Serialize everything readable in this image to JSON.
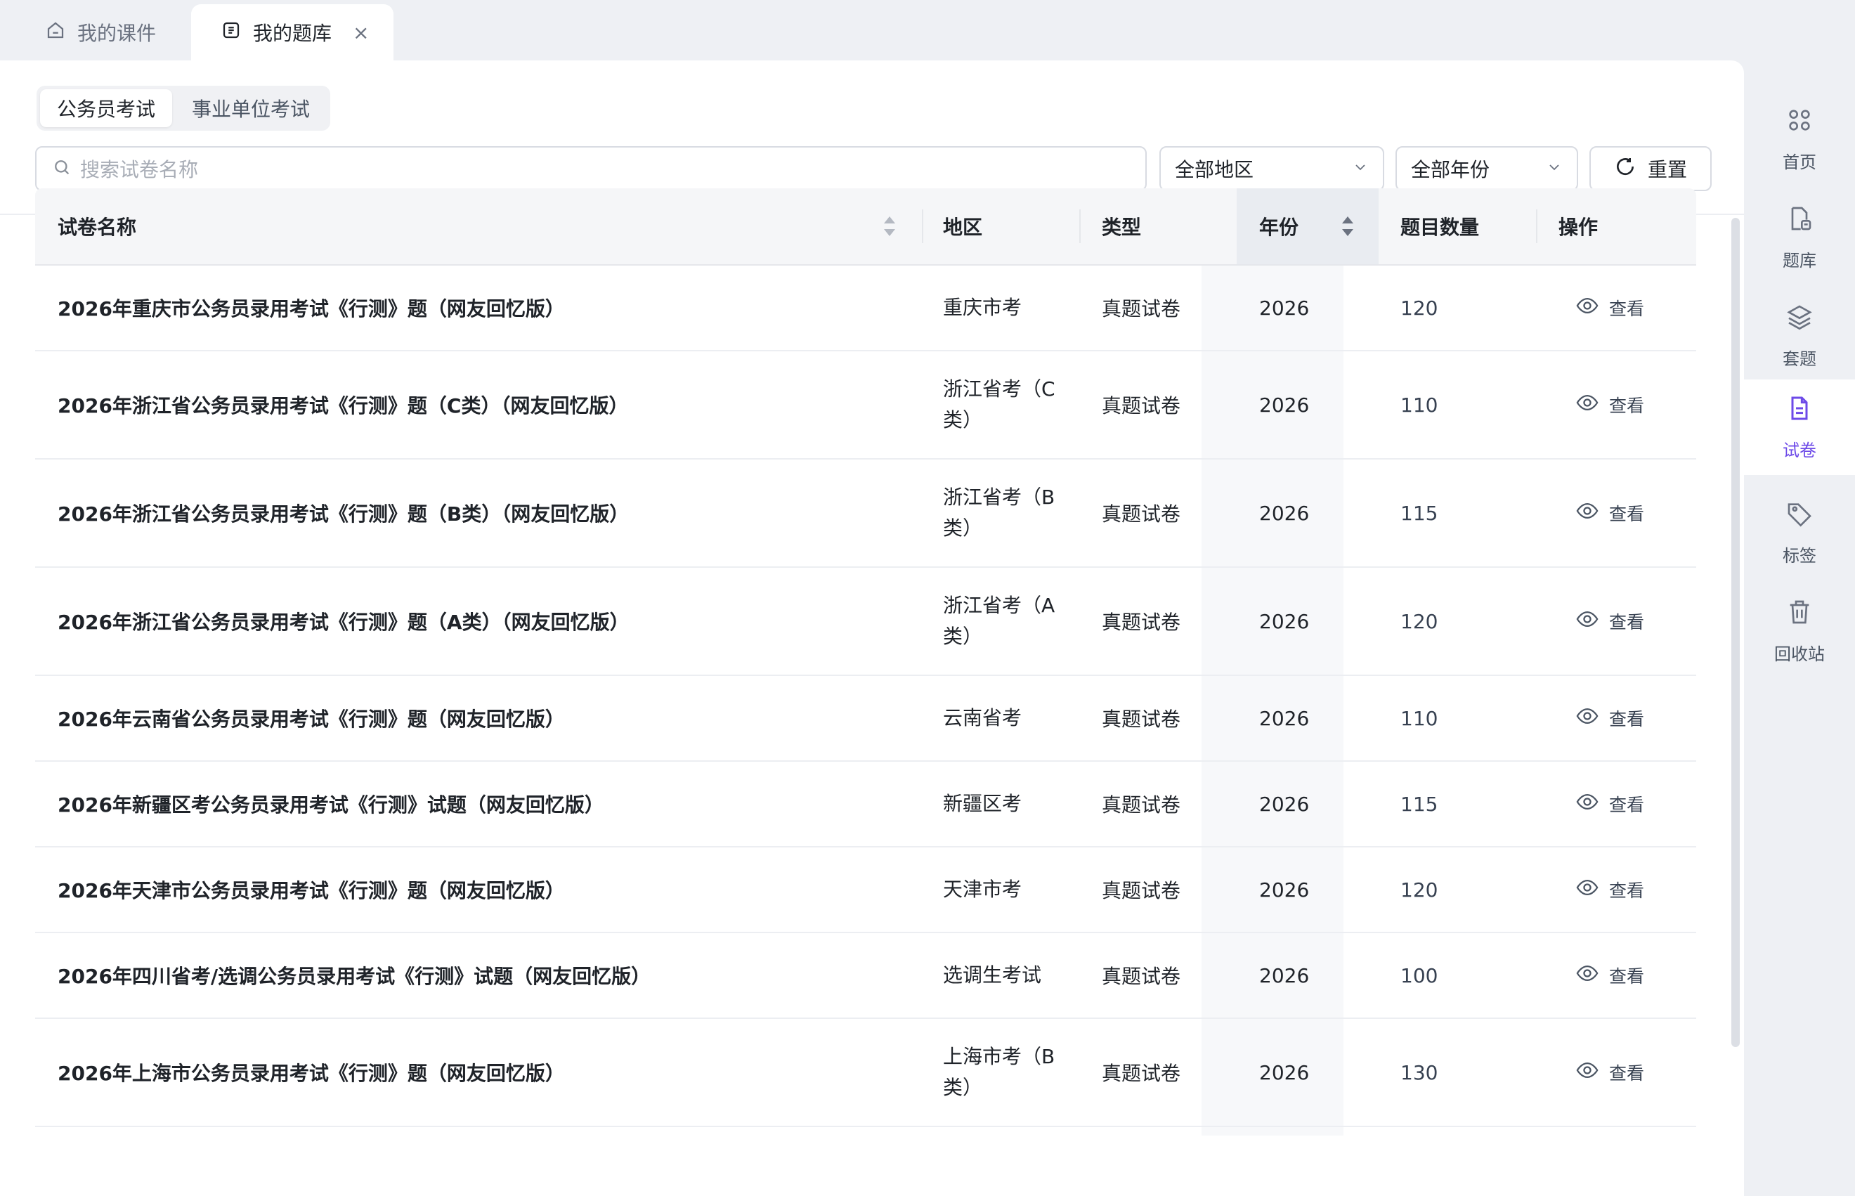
{
  "tabs": [
    {
      "label": "我的课件",
      "icon": "home-icon",
      "active": false
    },
    {
      "label": "我的题库",
      "icon": "question-bank-icon",
      "active": true,
      "close": "×"
    }
  ],
  "exam_types": [
    "公务员考试",
    "事业单位考试"
  ],
  "exam_type_selected": "公务员考试",
  "filters": {
    "search_placeholder": "搜索试卷名称",
    "region": "全部地区",
    "year": "全部年份",
    "reset": "重置"
  },
  "table": {
    "columns": [
      "试卷名称",
      "地区",
      "类型",
      "年份",
      "题目数量",
      "操作"
    ],
    "rows": [
      {
        "name": "2026年重庆市公务员录用考试《行测》题（网友回忆版）",
        "region": "重庆市考",
        "type": "真题试卷",
        "year": "2026",
        "count": "120",
        "action": "查看"
      },
      {
        "name": "2026年浙江省公务员录用考试《行测》题（C类）（网友回忆版）",
        "region": "浙江省考（C类）",
        "type": "真题试卷",
        "year": "2026",
        "count": "110",
        "action": "查看"
      },
      {
        "name": "2026年浙江省公务员录用考试《行测》题（B类）（网友回忆版）",
        "region": "浙江省考（B类）",
        "type": "真题试卷",
        "year": "2026",
        "count": "115",
        "action": "查看"
      },
      {
        "name": "2026年浙江省公务员录用考试《行测》题（A类）（网友回忆版）",
        "region": "浙江省考（A类）",
        "type": "真题试卷",
        "year": "2026",
        "count": "120",
        "action": "查看"
      },
      {
        "name": "2026年云南省公务员录用考试《行测》题（网友回忆版）",
        "region": "云南省考",
        "type": "真题试卷",
        "year": "2026",
        "count": "110",
        "action": "查看"
      },
      {
        "name": "2026年新疆区考公务员录用考试《行测》试题（网友回忆版）",
        "region": "新疆区考",
        "type": "真题试卷",
        "year": "2026",
        "count": "115",
        "action": "查看"
      },
      {
        "name": "2026年天津市公务员录用考试《行测》题（网友回忆版）",
        "region": "天津市考",
        "type": "真题试卷",
        "year": "2026",
        "count": "120",
        "action": "查看"
      },
      {
        "name": "2026年四川省考/选调公务员录用考试《行测》试题（网友回忆版）",
        "region": "选调生考试",
        "type": "真题试卷",
        "year": "2026",
        "count": "100",
        "action": "查看"
      },
      {
        "name": "2026年上海市公务员录用考试《行测》题（网友回忆版）",
        "region": "上海市考（B类）",
        "type": "真题试卷",
        "year": "2026",
        "count": "130",
        "action": "查看"
      }
    ]
  },
  "sidebar": {
    "items": [
      {
        "label": "首页",
        "icon": "grid-icon",
        "active": false
      },
      {
        "label": "题库",
        "icon": "question-bank-icon",
        "active": false
      },
      {
        "label": "套题",
        "icon": "layers-icon",
        "active": false
      },
      {
        "label": "试卷",
        "icon": "document-icon",
        "active": true
      },
      {
        "label": "标签",
        "icon": "tag-icon",
        "active": false
      },
      {
        "label": "回收站",
        "icon": "trash-icon",
        "active": false
      }
    ]
  },
  "colors": {
    "accent": "#6d4ae8",
    "text": "#1f2329",
    "muted": "#6b7280"
  }
}
